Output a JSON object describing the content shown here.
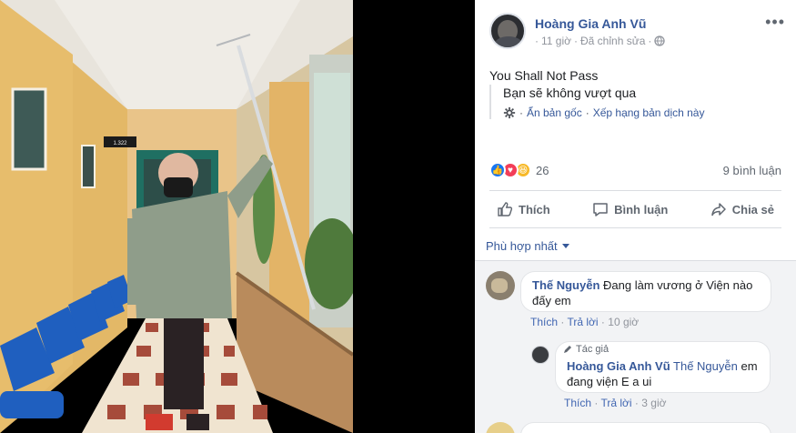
{
  "post": {
    "author": "Hoàng Gia Anh Vũ",
    "time": "11 giờ",
    "edited": "Đã chỉnh sửa",
    "text": "You Shall Not Pass",
    "translation": "Bạn sẽ không vượt qua",
    "hide_original": "Ẩn bản gốc",
    "rate_translation": "Xếp hạng bản dịch này",
    "reaction_count": "26",
    "comment_count": "9 bình luận"
  },
  "actions": {
    "like": "Thích",
    "comment": "Bình luận",
    "share": "Chia sẻ"
  },
  "sort": {
    "label": "Phù hợp nhất"
  },
  "comments": [
    {
      "author": "Thế Nguyễn",
      "text": "Đang làm vương ở Viện nào đấy em",
      "like": "Thích",
      "reply": "Trả lời",
      "time": "10 giờ"
    }
  ],
  "reply": {
    "badge": "Tác giả",
    "author": "Hoàng Gia Anh Vũ",
    "mention": "Thế Nguyễn",
    "text": "em đang viện E a ui",
    "like": "Thích",
    "reply": "Trả lời",
    "time": "3 giờ"
  },
  "photo_sign": "1.322",
  "icons": {
    "more": "ellipsis-icon",
    "privacy": "globe-icon",
    "settings": "gear-icon",
    "like": "thumbs-up-icon",
    "comment": "speech-bubble-icon",
    "share": "share-arrow-icon",
    "author_badge": "pencil-icon"
  },
  "colors": {
    "link": "#365899",
    "like_reaction": "#1877f2",
    "love_reaction": "#f33e58",
    "haha_reaction": "#f7b928"
  }
}
